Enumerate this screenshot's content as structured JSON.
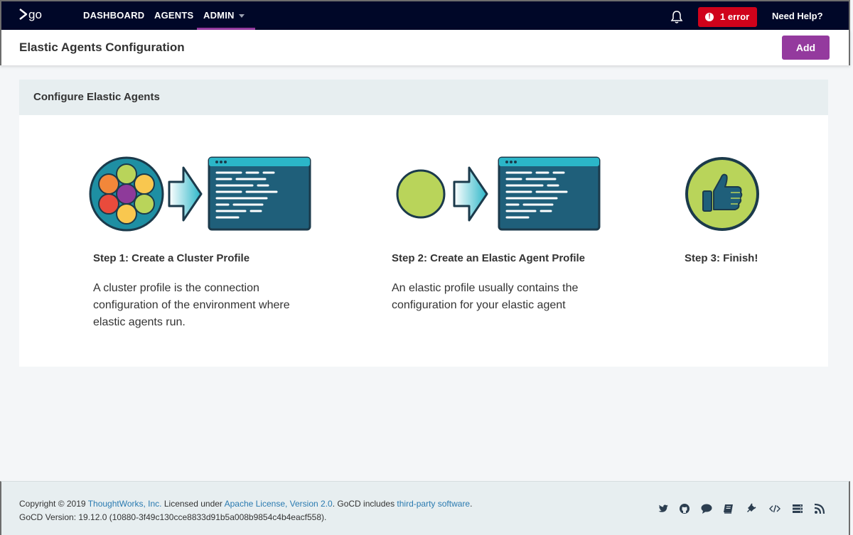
{
  "nav": {
    "items": [
      {
        "label": "DASHBOARD"
      },
      {
        "label": "AGENTS"
      },
      {
        "label": "ADMIN"
      }
    ],
    "error_label": "1 error",
    "error_icon": "!",
    "help_label": "Need Help?",
    "accent": "#943a9e",
    "error_color": "#d0021b"
  },
  "header": {
    "title": "Elastic Agents Configuration",
    "add_label": "Add"
  },
  "panel": {
    "title": "Configure Elastic Agents",
    "steps": [
      {
        "title": "Step 1: Create a Cluster Profile",
        "desc_lines": [
          "A cluster profile is the connection",
          "configuration of the environment where",
          "elastic agents run."
        ]
      },
      {
        "title": "Step 2: Create an Elastic Agent Profile",
        "desc_lines": [
          "An elastic profile usually contains the",
          "configuration for your elastic agent"
        ]
      },
      {
        "title": "Step 3: Finish!"
      }
    ]
  },
  "footer": {
    "copyright_prefix": "Copyright © 2019 ",
    "company": "ThoughtWorks, Inc.",
    "licensed_text": " Licensed under ",
    "license": "Apache License, Version 2.0",
    "includes_text": ". GoCD includes ",
    "third_party": "third-party software",
    "period": ".",
    "version": "GoCD Version: 19.12.0 (10880-3f49c130cce8833d91b5a008b9854c4b4eacf558).",
    "icons": [
      "twitter-icon",
      "github-icon",
      "chat-icon",
      "book-icon",
      "plugin-icon",
      "code-icon",
      "server-icon",
      "rss-icon"
    ]
  }
}
